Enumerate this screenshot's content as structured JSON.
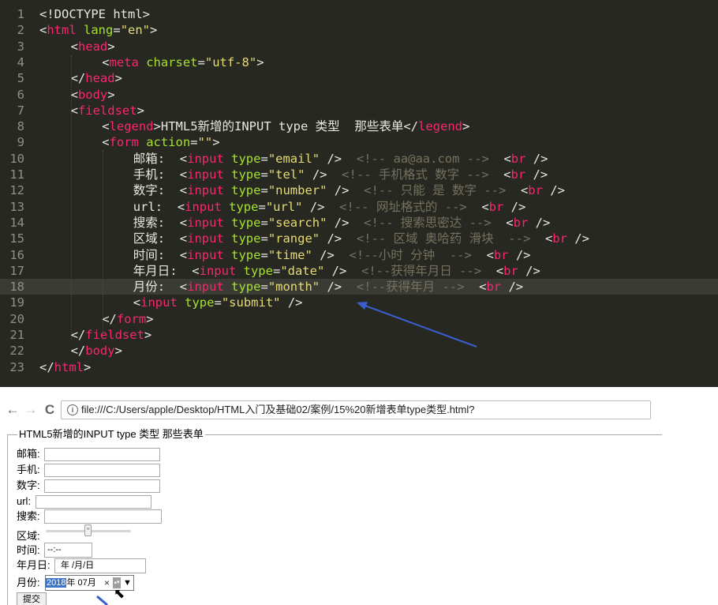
{
  "editor": {
    "lines": [
      {
        "n": "1",
        "tokens": [
          {
            "t": "<!DOCTYPE html>",
            "c": "g"
          }
        ]
      },
      {
        "n": "2",
        "tokens": [
          {
            "t": "<",
            "c": "g"
          },
          {
            "t": "html",
            "c": "t"
          },
          {
            "t": " lang",
            "c": "a"
          },
          {
            "t": "=",
            "c": "g"
          },
          {
            "t": "\"en\"",
            "c": "s"
          },
          {
            "t": ">",
            "c": "g"
          }
        ]
      },
      {
        "n": "3",
        "tokens": [
          {
            "t": "<",
            "c": "g"
          },
          {
            "t": "head",
            "c": "t"
          },
          {
            "t": ">",
            "c": "g"
          }
        ]
      },
      {
        "n": "4",
        "tokens": [
          {
            "t": "<",
            "c": "g"
          },
          {
            "t": "meta",
            "c": "t"
          },
          {
            "t": " charset",
            "c": "a"
          },
          {
            "t": "=",
            "c": "g"
          },
          {
            "t": "\"utf-8\"",
            "c": "s"
          },
          {
            "t": ">",
            "c": "g"
          }
        ]
      },
      {
        "n": "5",
        "tokens": [
          {
            "t": "</",
            "c": "g"
          },
          {
            "t": "head",
            "c": "t"
          },
          {
            "t": ">",
            "c": "g"
          }
        ]
      },
      {
        "n": "6",
        "tokens": [
          {
            "t": "<",
            "c": "g"
          },
          {
            "t": "body",
            "c": "t"
          },
          {
            "t": ">",
            "c": "g"
          }
        ]
      },
      {
        "n": "7",
        "tokens": [
          {
            "t": "<",
            "c": "g"
          },
          {
            "t": "fieldset",
            "c": "t"
          },
          {
            "t": ">",
            "c": "g"
          }
        ]
      },
      {
        "n": "8",
        "tokens": [
          {
            "t": "<",
            "c": "g"
          },
          {
            "t": "legend",
            "c": "t"
          },
          {
            "t": ">HTML5新增的INPUT type 类型  那些表单</",
            "c": "g"
          },
          {
            "t": "legend",
            "c": "t"
          },
          {
            "t": ">",
            "c": "g"
          }
        ]
      },
      {
        "n": "9",
        "tokens": [
          {
            "t": "<",
            "c": "g"
          },
          {
            "t": "form",
            "c": "t"
          },
          {
            "t": " action",
            "c": "a"
          },
          {
            "t": "=",
            "c": "g"
          },
          {
            "t": "\"\"",
            "c": "s"
          },
          {
            "t": ">",
            "c": "g"
          }
        ]
      },
      {
        "n": "10",
        "tokens": [
          {
            "t": "邮箱:  <",
            "c": "g"
          },
          {
            "t": "input",
            "c": "t"
          },
          {
            "t": " type",
            "c": "a"
          },
          {
            "t": "=",
            "c": "g"
          },
          {
            "t": "\"email\"",
            "c": "s"
          },
          {
            "t": " />  ",
            "c": "g"
          },
          {
            "t": "<!-- aa@aa.com -->",
            "c": "c"
          },
          {
            "t": "  <",
            "c": "g"
          },
          {
            "t": "br",
            "c": "t"
          },
          {
            "t": " />",
            "c": "g"
          }
        ]
      },
      {
        "n": "11",
        "tokens": [
          {
            "t": "手机:  <",
            "c": "g"
          },
          {
            "t": "input",
            "c": "t"
          },
          {
            "t": " type",
            "c": "a"
          },
          {
            "t": "=",
            "c": "g"
          },
          {
            "t": "\"tel\"",
            "c": "s"
          },
          {
            "t": " />  ",
            "c": "g"
          },
          {
            "t": "<!-- 手机格式 数字 -->",
            "c": "c"
          },
          {
            "t": "  <",
            "c": "g"
          },
          {
            "t": "br",
            "c": "t"
          },
          {
            "t": " />",
            "c": "g"
          }
        ]
      },
      {
        "n": "12",
        "tokens": [
          {
            "t": "数字:  <",
            "c": "g"
          },
          {
            "t": "input",
            "c": "t"
          },
          {
            "t": " type",
            "c": "a"
          },
          {
            "t": "=",
            "c": "g"
          },
          {
            "t": "\"number\"",
            "c": "s"
          },
          {
            "t": " />  ",
            "c": "g"
          },
          {
            "t": "<!-- 只能 是 数字 -->",
            "c": "c"
          },
          {
            "t": "  <",
            "c": "g"
          },
          {
            "t": "br",
            "c": "t"
          },
          {
            "t": " />",
            "c": "g"
          }
        ]
      },
      {
        "n": "13",
        "tokens": [
          {
            "t": "url:  <",
            "c": "g"
          },
          {
            "t": "input",
            "c": "t"
          },
          {
            "t": " type",
            "c": "a"
          },
          {
            "t": "=",
            "c": "g"
          },
          {
            "t": "\"url\"",
            "c": "s"
          },
          {
            "t": " />  ",
            "c": "g"
          },
          {
            "t": "<!-- 网址格式的 -->",
            "c": "c"
          },
          {
            "t": "  <",
            "c": "g"
          },
          {
            "t": "br",
            "c": "t"
          },
          {
            "t": " />",
            "c": "g"
          }
        ]
      },
      {
        "n": "14",
        "tokens": [
          {
            "t": "搜索:  <",
            "c": "g"
          },
          {
            "t": "input",
            "c": "t"
          },
          {
            "t": " type",
            "c": "a"
          },
          {
            "t": "=",
            "c": "g"
          },
          {
            "t": "\"search\"",
            "c": "s"
          },
          {
            "t": " />  ",
            "c": "g"
          },
          {
            "t": "<!-- 搜索思密达 -->",
            "c": "c"
          },
          {
            "t": "  <",
            "c": "g"
          },
          {
            "t": "br",
            "c": "t"
          },
          {
            "t": " />",
            "c": "g"
          }
        ]
      },
      {
        "n": "15",
        "tokens": [
          {
            "t": "区域:  <",
            "c": "g"
          },
          {
            "t": "input",
            "c": "t"
          },
          {
            "t": " type",
            "c": "a"
          },
          {
            "t": "=",
            "c": "g"
          },
          {
            "t": "\"range\"",
            "c": "s"
          },
          {
            "t": " />  ",
            "c": "g"
          },
          {
            "t": "<!-- 区域 奥哈药 滑块  -->",
            "c": "c"
          },
          {
            "t": "  <",
            "c": "g"
          },
          {
            "t": "br",
            "c": "t"
          },
          {
            "t": " />",
            "c": "g"
          }
        ]
      },
      {
        "n": "16",
        "tokens": [
          {
            "t": "时间:  <",
            "c": "g"
          },
          {
            "t": "input",
            "c": "t"
          },
          {
            "t": " type",
            "c": "a"
          },
          {
            "t": "=",
            "c": "g"
          },
          {
            "t": "\"time\"",
            "c": "s"
          },
          {
            "t": " />  ",
            "c": "g"
          },
          {
            "t": "<!--小时 分钟  -->",
            "c": "c"
          },
          {
            "t": "  <",
            "c": "g"
          },
          {
            "t": "br",
            "c": "t"
          },
          {
            "t": " />",
            "c": "g"
          }
        ]
      },
      {
        "n": "17",
        "tokens": [
          {
            "t": "年月日:  <",
            "c": "g"
          },
          {
            "t": "input",
            "c": "t"
          },
          {
            "t": " type",
            "c": "a"
          },
          {
            "t": "=",
            "c": "g"
          },
          {
            "t": "\"date\"",
            "c": "s"
          },
          {
            "t": " />  ",
            "c": "g"
          },
          {
            "t": "<!--获得年月日 -->",
            "c": "c"
          },
          {
            "t": "  <",
            "c": "g"
          },
          {
            "t": "br",
            "c": "t"
          },
          {
            "t": " />",
            "c": "g"
          }
        ]
      },
      {
        "n": "18",
        "tokens": [
          {
            "t": "月份:  <",
            "c": "g"
          },
          {
            "t": "input",
            "c": "t"
          },
          {
            "t": " type",
            "c": "a"
          },
          {
            "t": "=",
            "c": "g"
          },
          {
            "t": "\"month\"",
            "c": "s"
          },
          {
            "t": " />  ",
            "c": "g"
          },
          {
            "t": "<!--获得年月 -->",
            "c": "c"
          },
          {
            "t": "  <",
            "c": "g"
          },
          {
            "t": "br",
            "c": "t"
          },
          {
            "t": " />",
            "c": "g"
          }
        ]
      },
      {
        "n": "19",
        "tokens": [
          {
            "t": "<",
            "c": "g"
          },
          {
            "t": "input",
            "c": "t"
          },
          {
            "t": " type",
            "c": "a"
          },
          {
            "t": "=",
            "c": "g"
          },
          {
            "t": "\"submit\"",
            "c": "s"
          },
          {
            "t": " />",
            "c": "g"
          }
        ]
      },
      {
        "n": "20",
        "tokens": [
          {
            "t": "</",
            "c": "g"
          },
          {
            "t": "form",
            "c": "t"
          },
          {
            "t": ">",
            "c": "g"
          }
        ]
      },
      {
        "n": "21",
        "tokens": [
          {
            "t": "</",
            "c": "g"
          },
          {
            "t": "fieldset",
            "c": "t"
          },
          {
            "t": ">",
            "c": "g"
          }
        ]
      },
      {
        "n": "22",
        "tokens": [
          {
            "t": "</",
            "c": "g"
          },
          {
            "t": "body",
            "c": "t"
          },
          {
            "t": ">",
            "c": "g"
          }
        ]
      },
      {
        "n": "23",
        "tokens": [
          {
            "t": "</",
            "c": "g"
          },
          {
            "t": "html",
            "c": "t"
          },
          {
            "t": ">",
            "c": "g"
          }
        ]
      }
    ],
    "current_line": "18",
    "colors": {
      "background": "#272822",
      "tag": "#f92672",
      "attribute": "#a6e22e",
      "string": "#e6db74",
      "comment": "#75715e",
      "text": "#f8f8f2",
      "arrow": "#3a5fcd"
    }
  },
  "browser": {
    "back_icon": "←",
    "forward_icon": "→",
    "reload_icon": "C",
    "info_icon": "i",
    "url": "file:///C:/Users/apple/Desktop/HTML入门及基础02/案例/15%20新增表单type类型.html?",
    "legend": "HTML5新增的INPUT type 类型 那些表单",
    "fields": {
      "email_label": "邮箱:",
      "tel_label": "手机:",
      "number_label": "数字:",
      "url_label": "url:",
      "search_label": "搜索:",
      "range_label": "区域:",
      "time_label": "时间:",
      "time_value": "--:--",
      "date_label": "年月日:",
      "date_value": "年 /月/日",
      "month_label": "月份:",
      "month_year": "2018",
      "month_rest": "年 07月",
      "month_clear": "×",
      "month_dropdown": "▼",
      "submit_label": "提交"
    }
  }
}
